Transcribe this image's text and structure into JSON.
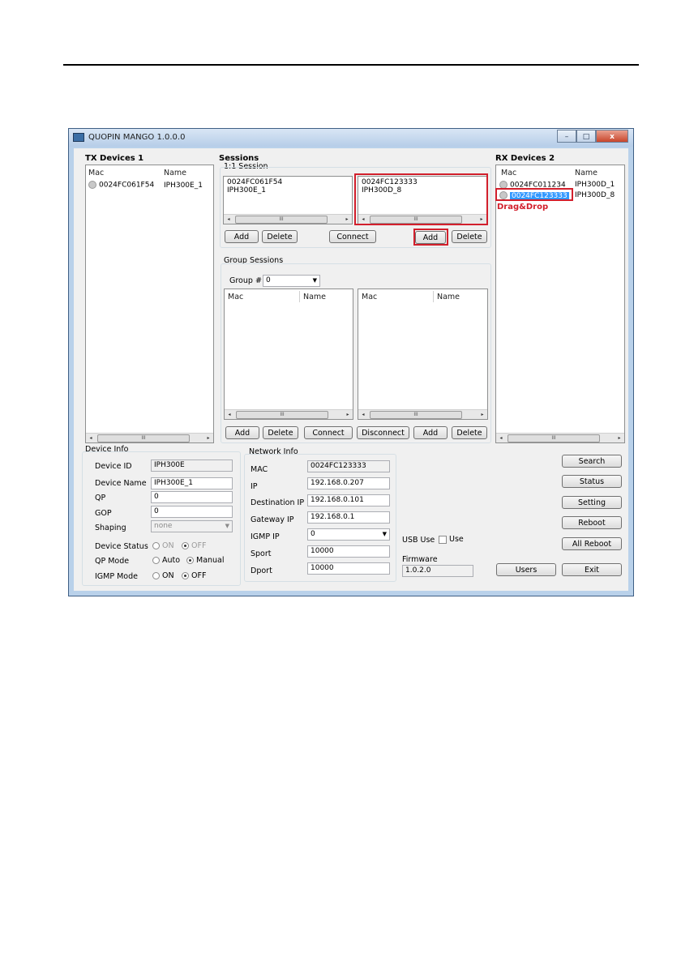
{
  "window": {
    "title": "QUOPIN MANGO 1.0.0.0",
    "minimize": "–",
    "maximize": "□",
    "close": "x"
  },
  "tx": {
    "title": "TX Devices 1",
    "col_mac": "Mac",
    "col_name": "Name",
    "rows": [
      {
        "mac": "0024FC061F54",
        "name": "IPH300E_1"
      }
    ]
  },
  "sessions": {
    "title": "Sessions",
    "one_to_one": {
      "title": "1:1 Session",
      "left": {
        "line1": "0024FC061F54",
        "line2": "IPH300E_1"
      },
      "right": {
        "line1": "0024FC123333",
        "line2": "IPH300D_8"
      },
      "add_left": "Add",
      "delete_left": "Delete",
      "connect": "Connect",
      "add_right": "Add",
      "delete_right": "Delete"
    },
    "group": {
      "title": "Group Sessions",
      "group_label": "Group #",
      "group_value": "0",
      "col_mac": "Mac",
      "col_name": "Name",
      "add_left": "Add",
      "delete_left": "Delete",
      "connect": "Connect",
      "disconnect": "Disconnect",
      "add_right": "Add",
      "delete_right": "Delete"
    }
  },
  "rx": {
    "title": "RX Devices 2",
    "col_mac": "Mac",
    "col_name": "Name",
    "rows": [
      {
        "mac": "0024FC011234",
        "name": "IPH300D_1"
      },
      {
        "mac": "0024FC123333",
        "name": "IPH300D_8"
      }
    ],
    "annotation": "Drag&Drop"
  },
  "device_info": {
    "title": "Device Info",
    "device_id_label": "Device ID",
    "device_id": "IPH300E",
    "device_name_label": "Device Name",
    "device_name": "IPH300E_1",
    "qp_label": "QP",
    "qp": "0",
    "gop_label": "GOP",
    "gop": "0",
    "shaping_label": "Shaping",
    "shaping": "none",
    "device_status_label": "Device Status",
    "status_on": "ON",
    "status_off": "OFF",
    "qp_mode_label": "QP Mode",
    "qp_auto": "Auto",
    "qp_manual": "Manual",
    "igmp_mode_label": "IGMP Mode",
    "igmp_on": "ON",
    "igmp_off": "OFF"
  },
  "network_info": {
    "title": "Network Info",
    "mac_label": "MAC",
    "mac": "0024FC123333",
    "ip_label": "IP",
    "ip": "192.168.0.207",
    "dest_ip_label": "Destination IP",
    "dest_ip": "192.168.0.101",
    "gateway_label": "Gateway IP",
    "gateway": "192.168.0.1",
    "igmp_ip_label": "IGMP IP",
    "igmp_ip": "0",
    "sport_label": "Sport",
    "sport": "10000",
    "dport_label": "Dport",
    "dport": "10000"
  },
  "usb": {
    "label": "USB Use",
    "checkbox_label": "Use"
  },
  "firmware": {
    "label": "Firmware",
    "value": "1.0.2.0"
  },
  "buttons": {
    "search": "Search",
    "status": "Status",
    "setting": "Setting",
    "reboot": "Reboot",
    "all_reboot": "All Reboot",
    "users": "Users",
    "exit": "Exit"
  },
  "scroll_thumb": "III",
  "arrow_left": "◂",
  "arrow_right": "▸",
  "dropdown": "▼"
}
